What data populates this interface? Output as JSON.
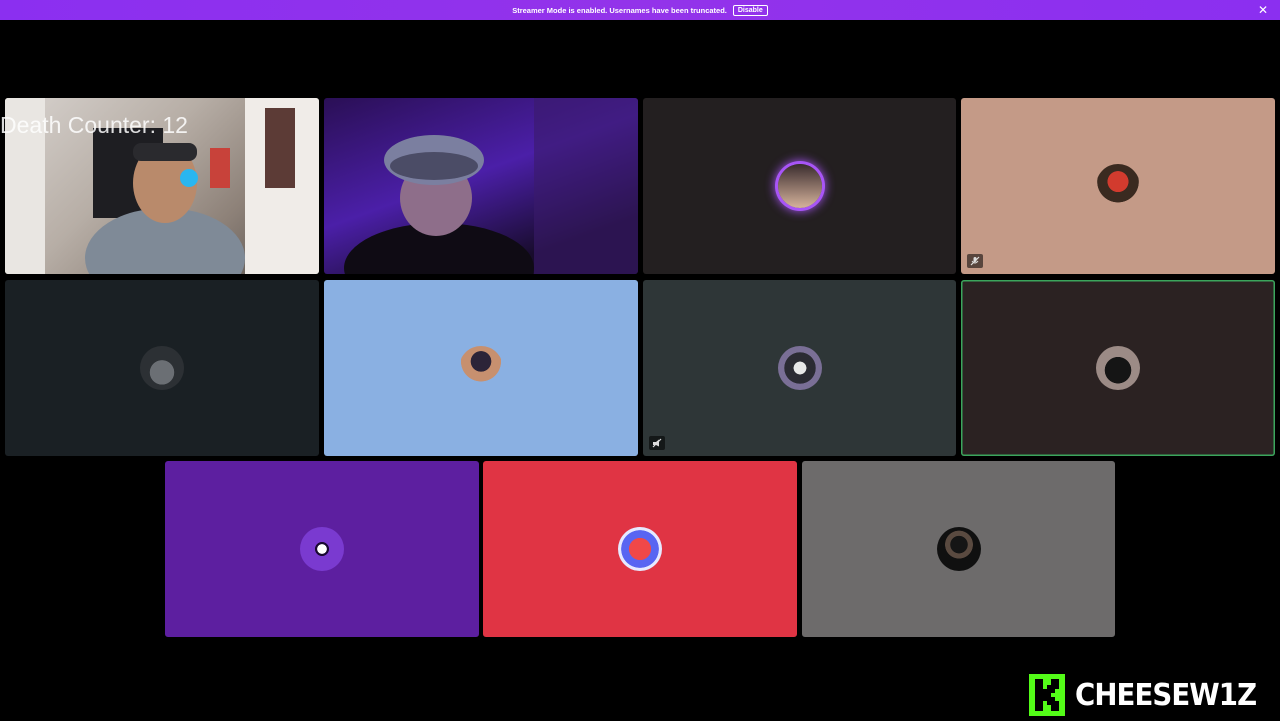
{
  "banner": {
    "message": "Streamer Mode is enabled. Usernames have been truncated.",
    "disable_label": "Disable",
    "close_icon": "close-icon"
  },
  "overlay": {
    "counter_text": "Death Counter: 12"
  },
  "tiles": [
    {
      "type": "video",
      "label": "camera feed 1"
    },
    {
      "type": "video",
      "label": "camera feed 2"
    },
    {
      "type": "avatar",
      "bg": "#231f20",
      "ring": "#a855f7"
    },
    {
      "type": "avatar",
      "bg": "#c49a87",
      "muted": true
    },
    {
      "type": "avatar",
      "bg": "#1a2024"
    },
    {
      "type": "avatar",
      "bg": "#8ab0e2"
    },
    {
      "type": "avatar",
      "bg": "#2e3637",
      "muted": true
    },
    {
      "type": "avatar",
      "bg": "#2b2222",
      "speaking": true
    },
    {
      "type": "avatar",
      "bg": "#5d1fa0"
    },
    {
      "type": "avatar",
      "bg": "#e03444"
    },
    {
      "type": "avatar",
      "bg": "#6d6b6b"
    }
  ],
  "brand": {
    "logo_icon": "kick-logo-icon",
    "name": "CHEESEW1Z",
    "accent": "#53fc18"
  }
}
